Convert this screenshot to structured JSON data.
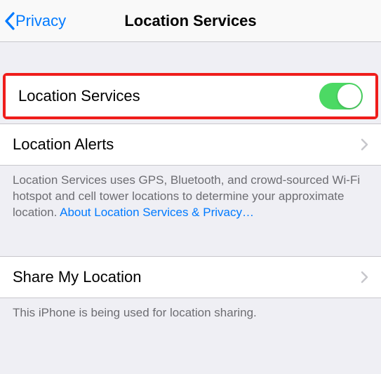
{
  "nav": {
    "back_label": "Privacy",
    "title": "Location Services"
  },
  "rows": {
    "location_services_label": "Location Services",
    "location_alerts_label": "Location Alerts",
    "share_my_location_label": "Share My Location"
  },
  "toggle": {
    "location_services_on": true
  },
  "footer": {
    "services_desc": "Location Services uses GPS, Bluetooth, and crowd-sourced Wi-Fi hotspot and cell tower locations to determine your approximate location. ",
    "services_link": "About Location Services & Privacy…",
    "share_desc": "This iPhone is being used for location sharing."
  },
  "colors": {
    "accent": "#007aff",
    "toggle_on": "#4cd964",
    "highlight": "#ef1d1b"
  }
}
